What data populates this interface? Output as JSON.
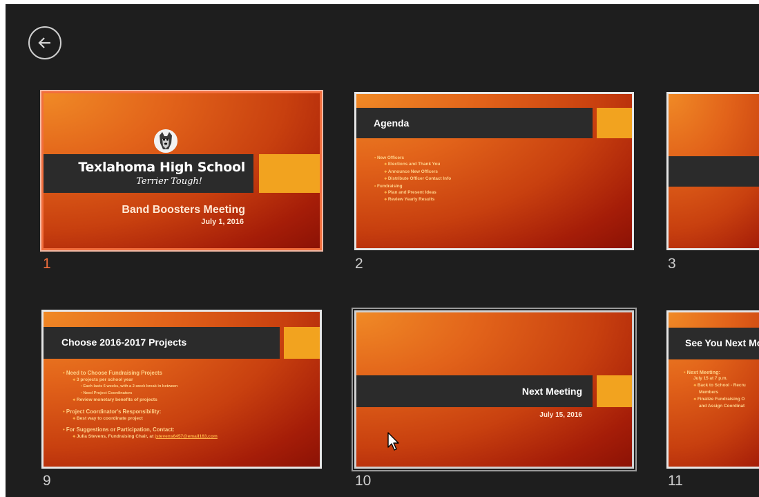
{
  "nav": {
    "back_label": "Back"
  },
  "slides": [
    {
      "number": "1",
      "school": "Texlahoma High School",
      "tagline": "Terrier Tough!",
      "title": "Band Boosters Meeting",
      "date": "July 1, 2016"
    },
    {
      "number": "2",
      "title": "Agenda",
      "bullets": [
        {
          "level": 1,
          "text": "New Officers"
        },
        {
          "level": 2,
          "text": "Elections and Thank You"
        },
        {
          "level": 2,
          "text": "Announce New Officers"
        },
        {
          "level": 2,
          "text": "Distribute Officer Contact Info"
        },
        {
          "level": 1,
          "text": "Fundraising"
        },
        {
          "level": 2,
          "text": "Plan and Present Ideas"
        },
        {
          "level": 2,
          "text": "Review Yearly Results"
        }
      ]
    },
    {
      "number": "3"
    },
    {
      "number": "9",
      "title": "Choose 2016-2017 Projects",
      "bullets": [
        {
          "level": 1,
          "text": "Need to Choose Fundraising Projects"
        },
        {
          "level": 2,
          "text": "3 projects per school year"
        },
        {
          "level": 3,
          "text": "Each lasts 6 weeks, with a 2-week break in between"
        },
        {
          "level": 3,
          "text": "Need Project Coordinators"
        },
        {
          "level": 2,
          "text": "Review monetary benefits of projects"
        },
        {
          "level": 1,
          "text": "Project Coordinator's Responsibility:",
          "gap": true
        },
        {
          "level": 2,
          "text": "Best way to coordinate project"
        },
        {
          "level": 1,
          "text": "For Suggestions or Participation, Contact:",
          "gap": true
        },
        {
          "level": 2,
          "text": "Julia Stevens, Fundraising Chair, at ",
          "link": "jstevens6457@email163.com"
        }
      ]
    },
    {
      "number": "10",
      "title": "Next Meeting",
      "date": "July 15, 2016"
    },
    {
      "number": "11",
      "title": "See You Next Mo",
      "bullets": [
        {
          "level": 1,
          "text": "Next Meeting:"
        },
        {
          "level": 0,
          "text": "July 15 at 7 p.m."
        },
        {
          "level": 2,
          "text": "Back to School - Recru"
        },
        {
          "level": 0,
          "text": "Members"
        },
        {
          "level": 2,
          "text": "Finalize Fundraising O"
        },
        {
          "level": 0,
          "text": "and Assign Coordinat"
        }
      ]
    }
  ]
}
